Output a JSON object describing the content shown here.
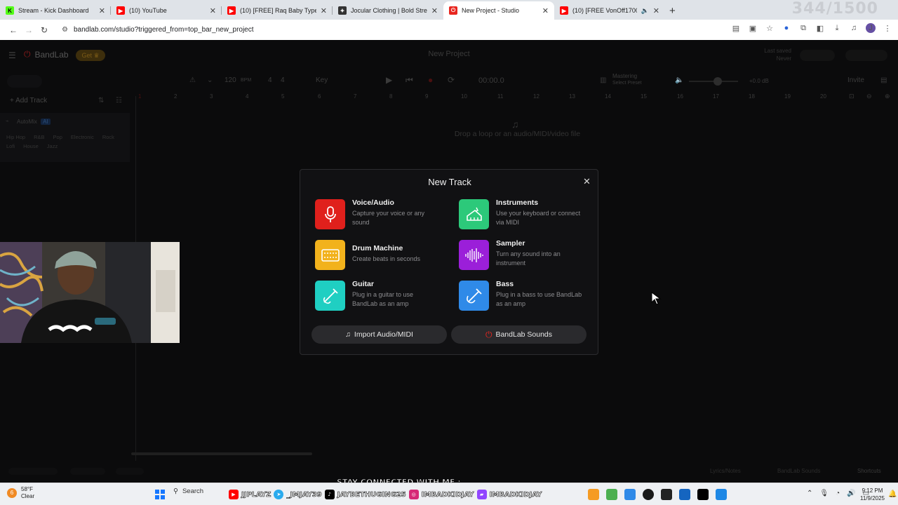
{
  "browser": {
    "tabs": [
      {
        "title": "Stream - Kick Dashboard",
        "icon": "kick-icon",
        "color": "#53fc18",
        "glyph": "K"
      },
      {
        "title": "(10) YouTube",
        "icon": "youtube-icon",
        "color": "#ff0000",
        "glyph": "▶"
      },
      {
        "title": "(10) [FREE] Raq Baby Type Beat",
        "icon": "youtube-icon",
        "color": "#ff0000",
        "glyph": "▶"
      },
      {
        "title": "Jocular Clothing | Bold Streetwe",
        "icon": "site-icon",
        "color": "#333333",
        "glyph": "✦"
      },
      {
        "title": "New Project - Studio",
        "icon": "bandlab-icon",
        "color": "#e8261f",
        "glyph": "⏻"
      },
      {
        "title": "(10) [FREE VonOff1700 Samp",
        "icon": "youtube-icon",
        "color": "#ff0000",
        "glyph": "▶"
      }
    ],
    "counter": "344/1500",
    "url": "bandlab.com/studio?triggered_from=top_bar_new_project",
    "profile_initial": "J"
  },
  "app": {
    "brand": "BandLab",
    "get_label": "Get",
    "project_title": "New Project",
    "last_saved_label": "Last saved",
    "last_saved_value": "Never",
    "tempo": "120",
    "tempo_unit": "BPM",
    "time_sig_num": "4",
    "time_sig_den": "4",
    "key_label": "Key",
    "time_display": "00:00.0",
    "mastering_label": "Mastering",
    "mastering_sub": "Select Preset",
    "volume_db": "+0.0 dB",
    "invite_label": "Invite",
    "add_track_label": "Add Track",
    "automix_label": "AutoMix",
    "automix_badge": "AI",
    "genres": [
      "Hip Hop",
      "R&B",
      "Pop",
      "Electronic",
      "Rock",
      "Lofi",
      "House",
      "Jazz"
    ],
    "ruler": [
      "1",
      "2",
      "3",
      "4",
      "5",
      "6",
      "7",
      "8",
      "9",
      "10",
      "11",
      "12",
      "13",
      "14",
      "15",
      "16",
      "17",
      "18",
      "19",
      "20"
    ],
    "drop_hint": "Drop a loop or an audio/MIDI/video file",
    "bottom": {
      "lyrics_notes": "Lyrics/Notes",
      "bandlab_sounds": "BandLab Sounds",
      "shortcuts": "Shortcuts"
    }
  },
  "modal": {
    "title": "New Track",
    "options": [
      {
        "name": "Voice/Audio",
        "desc": "Capture your voice or any sound",
        "color": "#e0201c",
        "icon": "microphone-icon"
      },
      {
        "name": "Instruments",
        "desc": "Use your keyboard or connect via MIDI",
        "color": "#2cc97a",
        "icon": "keyboard-icon"
      },
      {
        "name": "Drum Machine",
        "desc": "Create beats in seconds",
        "color": "#f2b21c",
        "icon": "drum-machine-icon"
      },
      {
        "name": "Sampler",
        "desc": "Turn any sound into an instrument",
        "color": "#9b1fd9",
        "icon": "waveform-icon"
      },
      {
        "name": "Guitar",
        "desc": "Plug in a guitar to use BandLab as an amp",
        "color": "#1fcfc2",
        "icon": "guitar-icon"
      },
      {
        "name": "Bass",
        "desc": "Plug in a bass to use BandLab as an amp",
        "color": "#2f8ae8",
        "icon": "bass-icon"
      }
    ],
    "import_label": "Import Audio/MIDI",
    "sounds_label": "BandLab Sounds"
  },
  "overlay": {
    "stay_connected": "STAY CONNECTED WITH ME :",
    "socials": [
      "JJPLAYZ",
      "_JMJAY39",
      "JAYBETHUGING25",
      "IMBADKIDJAY",
      "IMBADKIDJAY"
    ]
  },
  "taskbar": {
    "temp": "58°F",
    "condition": "Clear",
    "weather_badge": "6",
    "search_label": "Search",
    "time": "9:12 PM",
    "date": "11/9/2025"
  }
}
